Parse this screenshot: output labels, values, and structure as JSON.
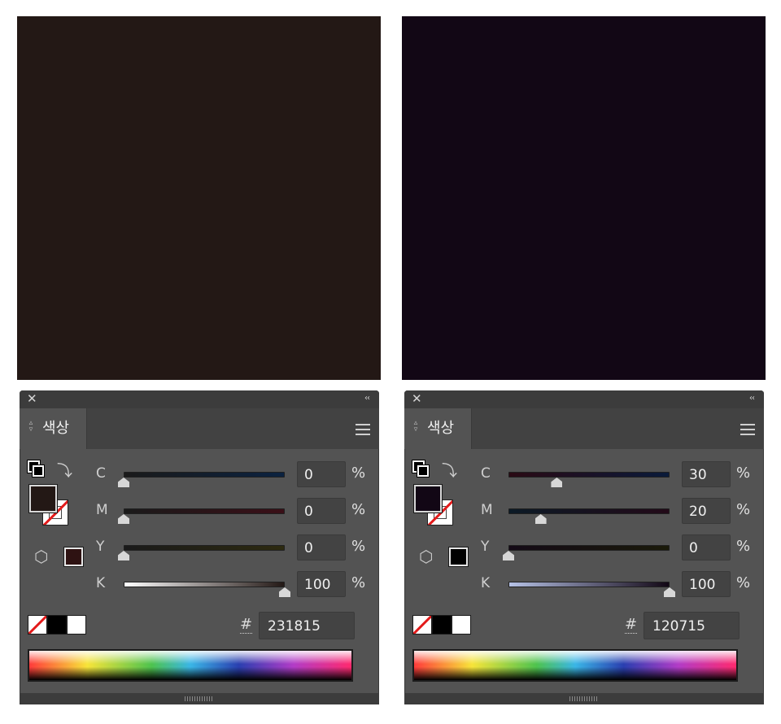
{
  "panels": [
    {
      "swatch_color": "#231815",
      "tab_label": "색상",
      "rows": [
        {
          "label": "C",
          "value": "0",
          "unit": "%",
          "fraction": 0.0,
          "track": "linear-gradient(to right, #1a1a1a, #0b2240)"
        },
        {
          "label": "M",
          "value": "0",
          "unit": "%",
          "fraction": 0.0,
          "track": "linear-gradient(to right, #1a1a1a, #3a0f17)"
        },
        {
          "label": "Y",
          "value": "0",
          "unit": "%",
          "fraction": 0.0,
          "track": "linear-gradient(to right, #1a1a1a, #2d2a10)"
        },
        {
          "label": "K",
          "value": "100",
          "unit": "%",
          "fraction": 1.0,
          "track": "linear-gradient(to right, #ffffff, #231815)"
        }
      ],
      "hash_label": "#",
      "hex_value": "231815",
      "fill_color": "#231815",
      "gamut_color": "#2e1212"
    },
    {
      "swatch_color": "#120715",
      "tab_label": "색상",
      "rows": [
        {
          "label": "C",
          "value": "30",
          "unit": "%",
          "fraction": 0.3,
          "track": "linear-gradient(to right, #2a0a14, #0a1a3a)"
        },
        {
          "label": "M",
          "value": "20",
          "unit": "%",
          "fraction": 0.2,
          "track": "linear-gradient(to right, #0c1a26, #220a18)"
        },
        {
          "label": "Y",
          "value": "0",
          "unit": "%",
          "fraction": 0.0,
          "track": "linear-gradient(to right, #140a16, #1a1a0a)"
        },
        {
          "label": "K",
          "value": "100",
          "unit": "%",
          "fraction": 1.0,
          "track": "linear-gradient(to right, #b6c2e6, #120715)"
        }
      ],
      "hash_label": "#",
      "hex_value": "120715",
      "fill_color": "#120715",
      "gamut_color": "#000000"
    }
  ],
  "icons": {
    "close": "close-icon",
    "collapse": "double-chevron-left-icon",
    "menu": "hamburger-menu-icon",
    "swap": "swap-arrow-icon",
    "cube": "cube-icon"
  }
}
